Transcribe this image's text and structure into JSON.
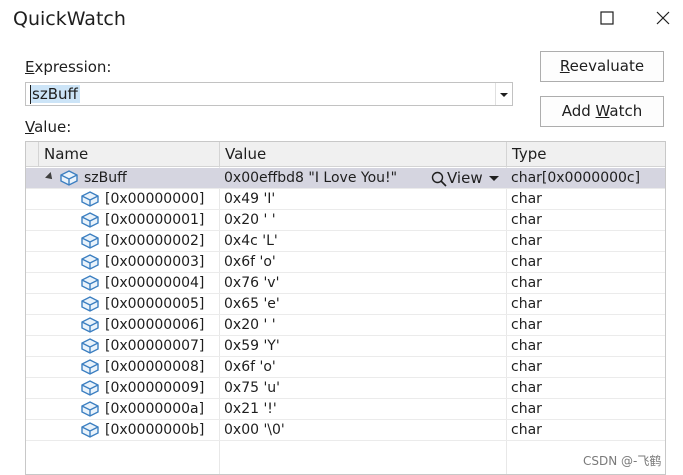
{
  "window": {
    "title": "QuickWatch"
  },
  "expression": {
    "label_pre": "",
    "label_ul": "E",
    "label_post": "xpression:",
    "value": "szBuff"
  },
  "value_label": {
    "ul": "V",
    "rest": "alue:"
  },
  "buttons": {
    "reevaluate_ul": "R",
    "reevaluate_rest": "eevaluate",
    "addwatch_pre": "Add ",
    "addwatch_ul": "W",
    "addwatch_post": "atch"
  },
  "grid": {
    "columns": [
      "Name",
      "Value",
      "Type"
    ],
    "root": {
      "name": "szBuff",
      "value": "0x00effbd8 \"I Love You!\"",
      "view_label": "View",
      "type": "char[0x0000000c]"
    },
    "rows": [
      {
        "name": "[0x00000000]",
        "value": "0x49 'I'",
        "type": "char"
      },
      {
        "name": "[0x00000001]",
        "value": "0x20 ' '",
        "type": "char"
      },
      {
        "name": "[0x00000002]",
        "value": "0x4c 'L'",
        "type": "char"
      },
      {
        "name": "[0x00000003]",
        "value": "0x6f 'o'",
        "type": "char"
      },
      {
        "name": "[0x00000004]",
        "value": "0x76 'v'",
        "type": "char"
      },
      {
        "name": "[0x00000005]",
        "value": "0x65 'e'",
        "type": "char"
      },
      {
        "name": "[0x00000006]",
        "value": "0x20 ' '",
        "type": "char"
      },
      {
        "name": "[0x00000007]",
        "value": "0x59 'Y'",
        "type": "char"
      },
      {
        "name": "[0x00000008]",
        "value": "0x6f 'o'",
        "type": "char"
      },
      {
        "name": "[0x00000009]",
        "value": "0x75 'u'",
        "type": "char"
      },
      {
        "name": "[0x0000000a]",
        "value": "0x21 '!'",
        "type": "char"
      },
      {
        "name": "[0x0000000b]",
        "value": "0x00 '\\0'",
        "type": "char"
      }
    ]
  },
  "watermark": "CSDN @-飞鹤",
  "colors": {
    "selection": "#cce4f7",
    "row_selected": "#d5d5e0",
    "cube": "#3c7fc1"
  }
}
